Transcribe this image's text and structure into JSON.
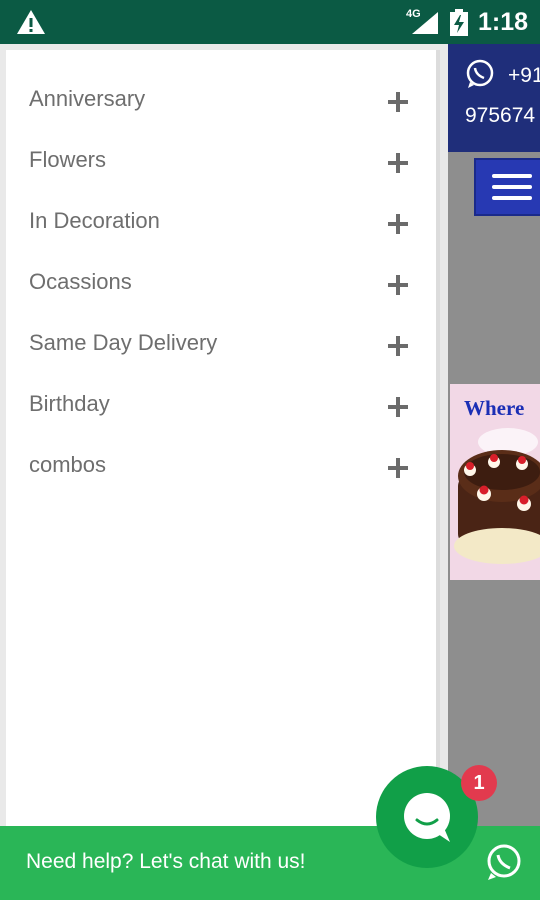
{
  "status_bar": {
    "network": "4G",
    "time": "1:18",
    "icons": [
      "warning-icon",
      "signal-icon",
      "battery-icon"
    ]
  },
  "background_page": {
    "phone_line1": "+91",
    "phone_line2": "975674",
    "banner_text": "Where"
  },
  "drawer": {
    "items": [
      {
        "label": "Anniversary"
      },
      {
        "label": "Flowers"
      },
      {
        "label": "In Decoration"
      },
      {
        "label": "Ocassions"
      },
      {
        "label": "Same Day Delivery"
      },
      {
        "label": "Birthday"
      },
      {
        "label": "combos"
      }
    ]
  },
  "chat": {
    "prompt": "Need help? Let's chat with us!",
    "badge_count": "1"
  },
  "colors": {
    "status_bar": "#0b5a44",
    "header": "#1f2e7a",
    "menu_button": "#2739b3",
    "chat_green": "#2ab657",
    "fab_green": "#119f48",
    "badge_red": "#e23a4e"
  }
}
